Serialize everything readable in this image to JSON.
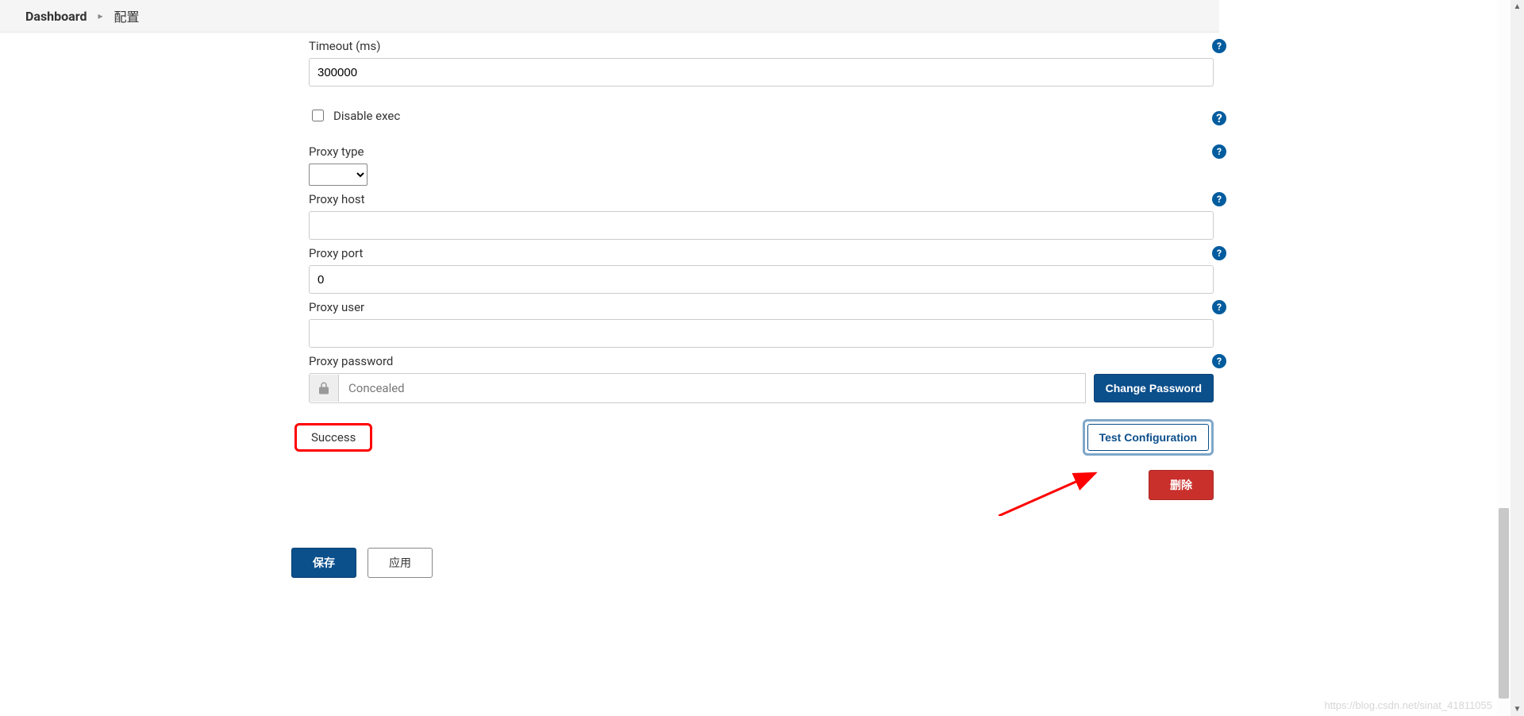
{
  "breadcrumb": {
    "root": "Dashboard",
    "current": "配置"
  },
  "fields": {
    "timeout": {
      "label": "Timeout (ms)",
      "value": "300000"
    },
    "disable_exec": {
      "label": "Disable exec",
      "checked": false
    },
    "proxy_type": {
      "label": "Proxy type",
      "value": ""
    },
    "proxy_host": {
      "label": "Proxy host",
      "value": ""
    },
    "proxy_port": {
      "label": "Proxy port",
      "value": "0"
    },
    "proxy_user": {
      "label": "Proxy user",
      "value": ""
    },
    "proxy_password": {
      "label": "Proxy password",
      "value": "Concealed",
      "change_label": "Change Password"
    }
  },
  "status": {
    "text": "Success"
  },
  "buttons": {
    "test": "Test Configuration",
    "delete": "删除",
    "save": "保存",
    "apply": "应用"
  },
  "watermark": "https://blog.csdn.net/sinat_41811055"
}
